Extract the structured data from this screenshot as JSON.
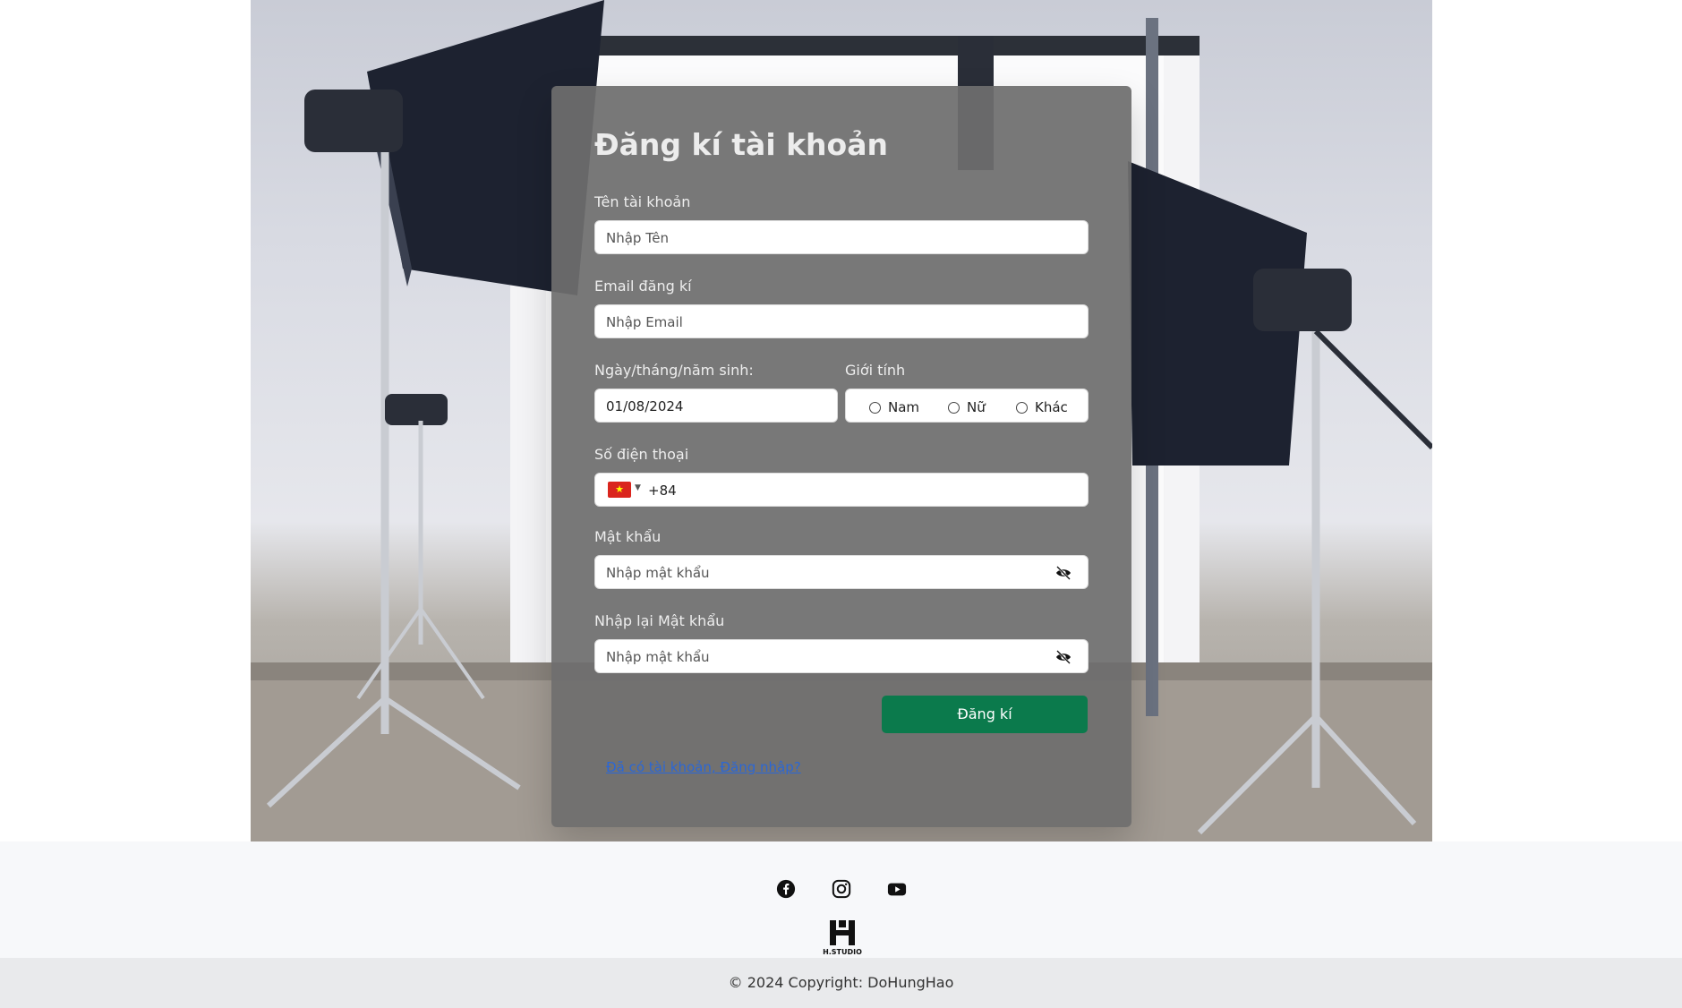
{
  "form": {
    "title": "Đăng kí tài khoản",
    "username": {
      "label": "Tên tài khoản",
      "placeholder": "Nhập Tên"
    },
    "email": {
      "label": "Email đăng kí",
      "placeholder": "Nhập Email"
    },
    "dob": {
      "label": "Ngày/tháng/năm sinh:",
      "value": "01/08/2024"
    },
    "gender": {
      "label": "Giới tính",
      "options": [
        "Nam",
        "Nữ",
        "Khác"
      ]
    },
    "phone": {
      "label": "Số điện thoại",
      "dial_code": "+84",
      "country_flag": "vietnam-flag-icon"
    },
    "password": {
      "label": "Mật khẩu",
      "placeholder": "Nhập mật khẩu"
    },
    "confirm_password": {
      "label": "Nhập lại Mật khẩu",
      "placeholder": "Nhập mật khẩu"
    },
    "submit_label": "Đăng kí",
    "login_link": "Đã có tài khoản, Đăng nhập?"
  },
  "footer": {
    "social_icons": [
      "facebook-icon",
      "instagram-icon",
      "youtube-icon"
    ],
    "logo_text": "H.STUDIO",
    "copyright": "© 2024 Copyright: DoHungHao"
  },
  "colors": {
    "submit_button": "#0b7a4c",
    "link": "#2b67d6",
    "card_overlay": "#6e6e6e"
  }
}
